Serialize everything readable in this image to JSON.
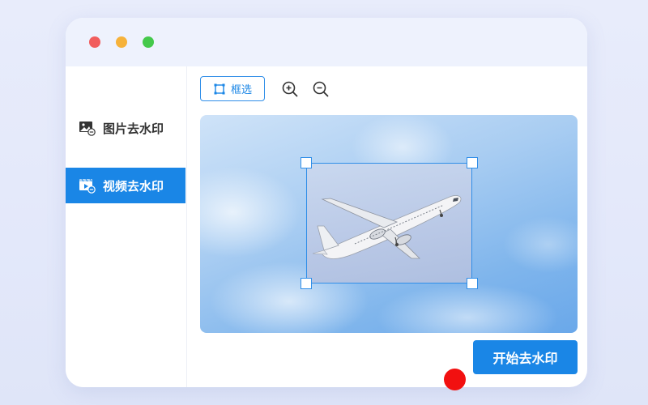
{
  "window": {
    "controls": [
      "close",
      "minimize",
      "maximize"
    ]
  },
  "sidebar": {
    "items": [
      {
        "label": "图片去水印",
        "icon": "image-icon",
        "active": false
      },
      {
        "label": "视频去水印",
        "icon": "video-icon",
        "active": true
      }
    ]
  },
  "toolbar": {
    "select_label": "框选",
    "select_icon": "crop-frame-icon",
    "zoom_in_icon": "zoom-in-icon",
    "zoom_out_icon": "zoom-out-icon"
  },
  "main": {
    "start_label": "开始去水印"
  },
  "colors": {
    "accent": "#1a86e6",
    "window_bg": "#ffffff",
    "titlebar_bg": "#eef2fd",
    "close": "#f15d5d",
    "minimize": "#f6b23a",
    "maximize": "#44c94b",
    "cursor": "#f21010"
  }
}
